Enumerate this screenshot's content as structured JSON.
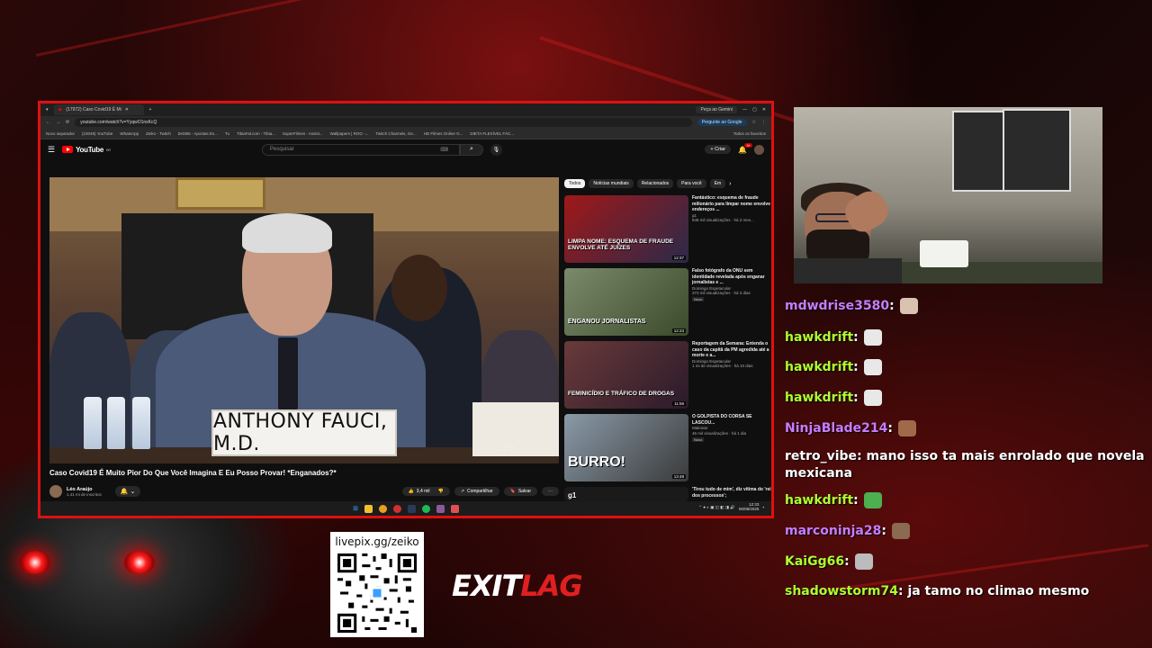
{
  "browser": {
    "tab_title": "(17972) Caso Covid19 É Mi",
    "gemini_label": "Peça ao Gemini",
    "url": "youtube.com/watch?v=YyqwO1nsKcQ",
    "google_pill": "Pergunte ao Google",
    "bookmarks": [
      "Novo separador",
      "(10049) YouTube",
      "WhatsApp",
      "Zeiko - Twitch",
      "bet365 - Apostas Es...",
      "Tu",
      "TibiaFal.com - Tibia...",
      "SuperFilmes - Assist...",
      "Wallpapers | ROG -...",
      "Twitch Channels, Ge...",
      "HD Filmes Online G...",
      "DIETA FLEXÍVEL FÁC..."
    ],
    "bookmarks_all": "Todos os favoritos"
  },
  "youtube": {
    "logo": "YouTube",
    "logo_region": "BR",
    "search_placeholder": "Pesquisar",
    "create_label": "Criar",
    "notif_count": "9+",
    "video": {
      "nameplate": "ANTHONY FAUCI, M.D.",
      "watermark": "C  V",
      "title": "Caso Covid19 É Muito Pior Do Que Você Imagina E Eu Posso Provar! *Enganados?*",
      "channel": "Léo Araújo",
      "subs": "1,41 mi de inscritos",
      "likes": "3,4 mil",
      "share": "Compartilhar",
      "save": "Salvar"
    },
    "chips": [
      "Todos",
      "Notícias mundiais",
      "Relacionados",
      "Para você",
      "Em"
    ],
    "recs": [
      {
        "thumb_text": "LIMPA NOME: ESQUEMA DE FRAUDE ENVOLVE ATÉ JUÍZES",
        "duration": "12:37",
        "title": "Fantástico: esquema de fraude milionário para limpar nome envolve endereços ...",
        "channel": "g1",
        "meta": "849 mil visualizações · há 2 mes...",
        "badge": ""
      },
      {
        "thumb_text": "ENGANOU JORNALISTAS",
        "duration": "12:23",
        "title": "Falso fotógrafo da ONU sem identidade revelada após enganar jornalistas e ...",
        "channel": "Domingo Espetacular",
        "meta": "373 mil visualizações · há 3 dias",
        "badge": "Novo"
      },
      {
        "thumb_text": "FEMINICÍDIO E TRÁFICO DE DROGAS",
        "duration": "11:59",
        "title": "Reportagem da Semana: Entenda o caso da capitã da PM agredida até a morte e a...",
        "channel": "Domingo Espetacular",
        "meta": "1 mi de visualizações · há 10 dias",
        "badge": ""
      },
      {
        "thumb_text": "BURRO!",
        "duration": "13:48",
        "title": "O GOLPISTA DO CORSA SE LASCOU...",
        "channel": "Makrator",
        "meta": "45 mil visualizações · há 1 dia",
        "badge": "Novo"
      },
      {
        "thumb_text": "g1",
        "duration": "",
        "title": "'Tirou tudo de mim', diz vítima do 'rei dos processos';",
        "channel": "",
        "meta": "",
        "badge": ""
      }
    ]
  },
  "taskbar": {
    "time": "12:33",
    "date": "06/08/2025"
  },
  "chat": [
    {
      "user": "mdwdrise3580",
      "color": "#c77dff",
      "text": "",
      "emote": "#d9c2b0"
    },
    {
      "user": "hawkdrift",
      "color": "#adff2f",
      "text": "",
      "emote": "#e8e8e8"
    },
    {
      "user": "hawkdrift",
      "color": "#adff2f",
      "text": "",
      "emote": "#e8e8e8"
    },
    {
      "user": "hawkdrift",
      "color": "#adff2f",
      "text": "",
      "emote": "#e8e8e8"
    },
    {
      "user": "NinjaBlade214",
      "color": "#c77dff",
      "text": "",
      "emote": "#a06a4a"
    },
    {
      "user": "retro_vibe",
      "color": "#ffffff",
      "text": "mano isso ta mais enrolado que novela mexicana",
      "emote": ""
    },
    {
      "user": "hawkdrift",
      "color": "#adff2f",
      "text": "",
      "emote": "#4caf50"
    },
    {
      "user": "marconinja28",
      "color": "#c77dff",
      "text": "",
      "emote": "#8a6a50"
    },
    {
      "user": "KaiGg66",
      "color": "#adff2f",
      "text": "",
      "emote": "#bbbbbb"
    },
    {
      "user": "shadowstorm74",
      "color": "#adff2f",
      "text": "ja tamo no climao mesmo",
      "emote": ""
    }
  ],
  "overlay": {
    "qr_label": "livepix.gg/zeiko",
    "logo_exit": "EXIT",
    "logo_lag": "LAG"
  }
}
